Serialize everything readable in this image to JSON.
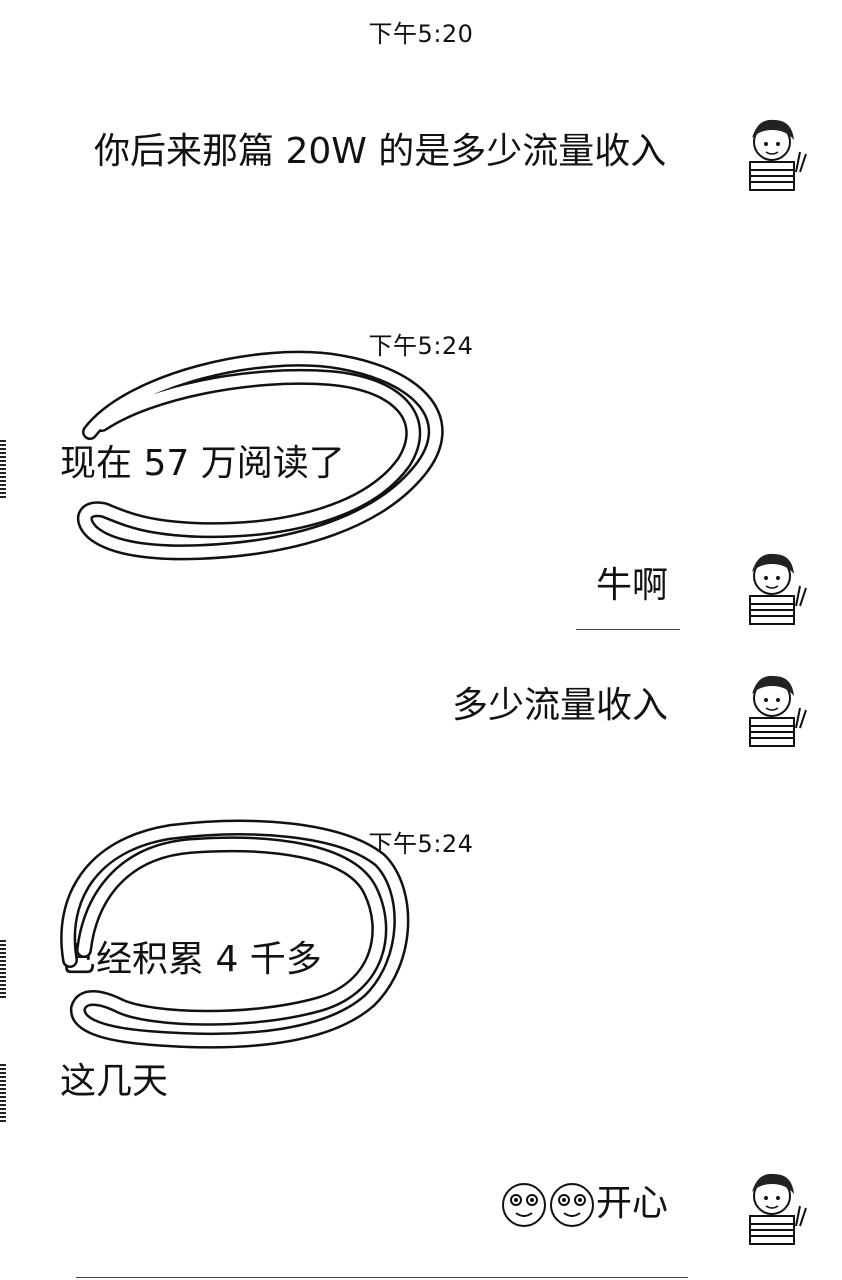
{
  "timestamps": [
    "下午5:20",
    "下午5:24",
    "下午5:24"
  ],
  "messages": [
    {
      "text": "你后来那篇 20W 的是多少流量收入",
      "side": "right"
    },
    {
      "text": "现在 57 万阅读了",
      "side": "left"
    },
    {
      "text": "牛啊",
      "side": "right"
    },
    {
      "text": "多少流量收入",
      "side": "right"
    },
    {
      "text": "已经积累 4 千多",
      "side": "left"
    },
    {
      "text": "这几天",
      "side": "left"
    },
    {
      "text": "开心",
      "side": "right"
    }
  ]
}
